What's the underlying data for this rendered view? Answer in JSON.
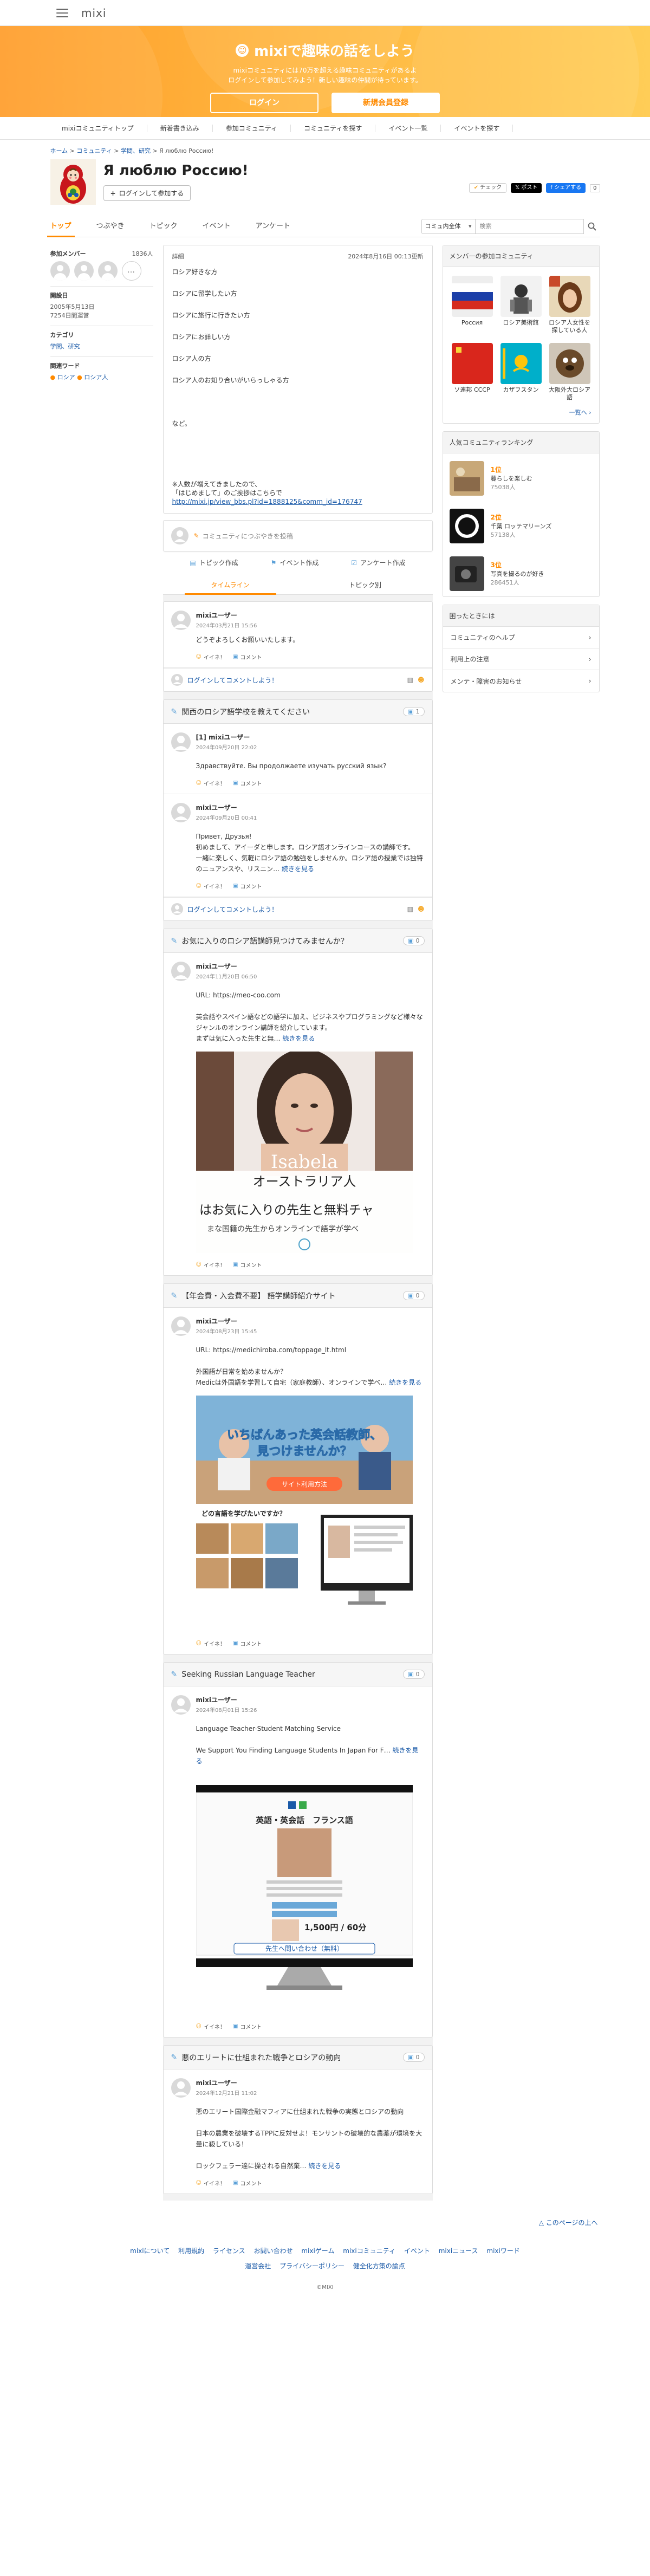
{
  "header": {
    "logo": "mixi"
  },
  "hero": {
    "title": "mixiで趣味の話をしよう",
    "desc1": "mixiコミュニティには70万を超える趣味コミュニティがあるよ",
    "desc2": "ログインして参加してみよう！新しい趣味の仲間が待っています。",
    "login": "ログイン",
    "register": "新規会員登録"
  },
  "globalnav": [
    "mixiコミュニティトップ",
    "新着書き込み",
    "参加コミュニティ",
    "コミュニティを探す",
    "イベント一覧",
    "イベントを探す"
  ],
  "breadcrumb": {
    "top": "ホーム",
    "comm": "コミュニティ",
    "cat": "学問、研究",
    "current": "Я люблю Россию!"
  },
  "community": {
    "title": "Я люблю Россию!",
    "join": "ログインして参加する",
    "check": "チェック",
    "post": "ポスト",
    "share": "シェアする",
    "share_count": "0"
  },
  "tabs": [
    "トップ",
    "つぶやき",
    "トピック",
    "イベント",
    "アンケート"
  ],
  "search": {
    "scope": "コミュ内全体",
    "placeholder": "検索"
  },
  "left": {
    "members_label": "参加メンバー",
    "members_count": "1836人",
    "since_label": "開設日",
    "since_date": "2005年5月13日",
    "since_elapsed": "7254日間運営",
    "cat_label": "カテゴリ",
    "cat_value": "学問、研究",
    "kw_label": "関連ワード",
    "kw1": "ロシア",
    "kw2": "ロシア人"
  },
  "detail": {
    "label": "詳細",
    "date": "2024年8月16日 00:13更新",
    "l1": "ロシア好きな方",
    "l2": "ロシアに留学したい方",
    "l3": "ロシアに旅行に行きたい方",
    "l4": "ロシアにお詳しい方",
    "l5": "ロシア人の方",
    "l6": "ロシア人のお知り合いがいらっしゃる方",
    "l7": "など。",
    "l8": "※人数が増えてきましたので、",
    "l9": "「はじめまして」のご挨拶はこちらで",
    "link": "http://mixi.jp/view_bbs.pl?id=1888125&comm_id=176747"
  },
  "postbox": {
    "placeholder": "コミュニティにつぶやきを投稿"
  },
  "actions": {
    "topic": "トピック作成",
    "event": "イベント作成",
    "survey": "アンケート作成"
  },
  "timeline_tabs": {
    "timeline": "タイムライン",
    "topics": "トピック別"
  },
  "feed": {
    "greet": {
      "user": "mixiユーザー",
      "time": "2024年03月21日 15:56",
      "text": "どうぞよろしくお願いいたします。",
      "like": "イイネ！",
      "comment": "コメント"
    },
    "comment_prompt": "ログインしてコメントしよう！",
    "t1": {
      "title": "関西のロシア語学校を教えてください",
      "count": "1",
      "e1": {
        "user": "[1] mixiユーザー",
        "time": "2024年09月20日 22:02",
        "text": "Здравствуйте. Вы продолжаете изучать русский язык?"
      },
      "e2": {
        "user": "mixiユーザー",
        "time": "2024年09月20日 00:41",
        "text": "Привет, Друзья!\n初めまして、アイーダと申します。ロシア語オンラインコースの講師です。\n一緒に楽しく、気軽にロシア語の勉強をしませんか。ロシア語の授業では独特のニュアンスや、リスニン…",
        "more": "続きを見る"
      }
    },
    "t2": {
      "title": "お気に入りのロシア語講師見つけてみませんか？",
      "count": "0",
      "user": "mixiユーザー",
      "time": "2024年11月20日 06:50",
      "text": "URL: https://meo-coo.com\n\n英会話やスペイン語などの語学に加え、ビジネスやプログラミングなど様々なジャンルのオンライン講師を紹介しています。\nまずは気に入った先生と無…",
      "more": "続きを見る",
      "b_name": "Isabela",
      "b_lang": "オーストラリア人",
      "b_l1": "はお気に入りの先生と無料チャ",
      "b_l2": "まな国籍の先生からオンラインで語学が学べ"
    },
    "t3": {
      "title": "【年会費・入会費不要】 語学講師紹介サイト",
      "count": "0",
      "user": "mixiユーザー",
      "time": "2024年08月23日 15:45",
      "text": "URL: https://medichiroba.com/toppage_lt.html\n\n外国語が日常を始めませんか？\nMedicは外国語を学習して自宅（家庭教師）、オンラインで学べ…",
      "more": "続きを見る",
      "b_h": "いちばんあった英会話教師、\n見つけませんか？",
      "b_btn": "サイト利用方法",
      "b_q": "どの言語を学びたいですか？"
    },
    "t4": {
      "title": "Seeking Russian Language Teacher",
      "count": "0",
      "user": "mixiユーザー",
      "time": "2024年08月01日 15:26",
      "text": "Language Teacher-Student Matching Service\n\nWe Support You Finding Language Students In Japan For F…",
      "more": "続きを見る",
      "b_h": "英語・英会話　フランス語",
      "b_price": "1,500円 / 60分",
      "b_btn": "先生へ問い合わせ（無料）"
    },
    "t5": {
      "title": "悪のエリートに仕組まれた戦争とロシアの動向",
      "count": "0",
      "user": "mixiユーザー",
      "time": "2024年12月21日 11:02",
      "text": "悪のエリート国際金融マフィアに仕組まれた戦争の実態とロシアの動向\n\n日本の農業を破壊するTPPに反対せよ！モンサントの破壊的な農薬が環境を大量に殺している！\n\nロックフェラー達に操される自然棄…",
      "more": "続きを見る"
    }
  },
  "right": {
    "members_title": "メンバーの参加コミュニティ",
    "comms": [
      {
        "name": "Россия"
      },
      {
        "name": "ロシア美術館"
      },
      {
        "name": "ロシア人女性を探している人"
      },
      {
        "name": "ソ連邦 СССР"
      },
      {
        "name": "カザフスタン"
      },
      {
        "name": "大阪外大ロシア語"
      }
    ],
    "more": "一覧へ",
    "ranking_title": "人気コミュニティランキング",
    "rank": [
      {
        "pos": "1位",
        "name": "暮らしを楽しむ",
        "num": "75038人"
      },
      {
        "pos": "2位",
        "name": "千葉 ロッテマリーンズ",
        "num": "57138人"
      },
      {
        "pos": "3位",
        "name": "写真を撮るのが好き",
        "num": "286451人"
      }
    ],
    "help_title": "困ったときには",
    "help": [
      "コミュニティのヘルプ",
      "利用上の注意",
      "メンテ・障害のお知らせ"
    ]
  },
  "pagetop": "△ このページの上へ",
  "footer": {
    "row1": [
      "mixiについて",
      "利用規約",
      "ライセンス",
      "お問い合わせ",
      "mixiゲーム",
      "mixiコミュニティ",
      "イベント",
      "mixiニュース",
      "mixiワード"
    ],
    "row2": [
      "運営会社",
      "プライバシーポリシー",
      "健全化方策の論点"
    ],
    "copy": "©MIXI"
  },
  "colors": {
    "accent": "#ff8a00",
    "link": "#1a5aa8",
    "hero_from": "#ff9d2a",
    "hero_to": "#ffcd57"
  }
}
